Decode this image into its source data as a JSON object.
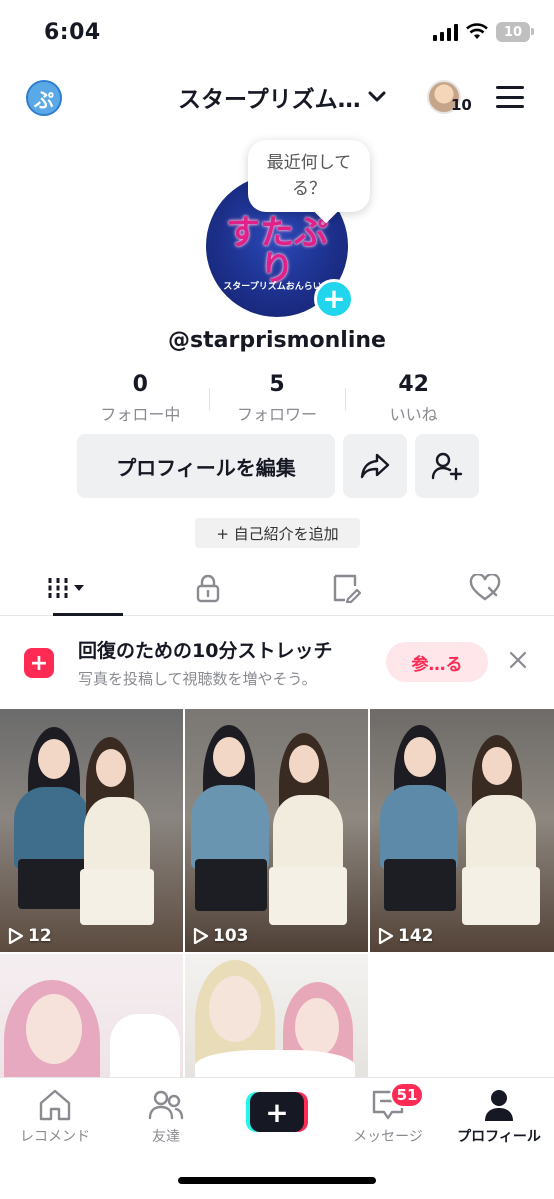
{
  "status_bar": {
    "time": "6:04",
    "battery": "10"
  },
  "header": {
    "account_name": "スタープリズム…",
    "avatar_count": "10"
  },
  "profile": {
    "bubble_text": "最近何してる？",
    "avatar_logo": "すたぷり",
    "avatar_sub": "スタープリズムおんらいん",
    "username": "@starprismonline",
    "stats": [
      {
        "value": "0",
        "label": "フォロー中"
      },
      {
        "value": "5",
        "label": "フォロワー"
      },
      {
        "value": "42",
        "label": "いいね"
      }
    ],
    "edit_label": "プロフィールを編集",
    "bio_label": "+ 自己紹介を追加"
  },
  "tabs": [
    "videos-grid",
    "private-lock",
    "reposts",
    "liked"
  ],
  "promo": {
    "title": "回復のための10分ストレッチ",
    "subtitle": "写真を投稿して視聴数を増やそう。",
    "cta": "参…る"
  },
  "videos": [
    {
      "views": "12"
    },
    {
      "views": "103"
    },
    {
      "views": "142"
    },
    {
      "views": ""
    },
    {
      "views": ""
    }
  ],
  "bottom_nav": {
    "items": [
      "レコメンド",
      "友達",
      "",
      "メッセージ",
      "プロフィール"
    ],
    "message_badge": "51"
  },
  "colors": {
    "accent": "#fe2c55",
    "teal": "#20d5ec",
    "text": "#161823"
  }
}
